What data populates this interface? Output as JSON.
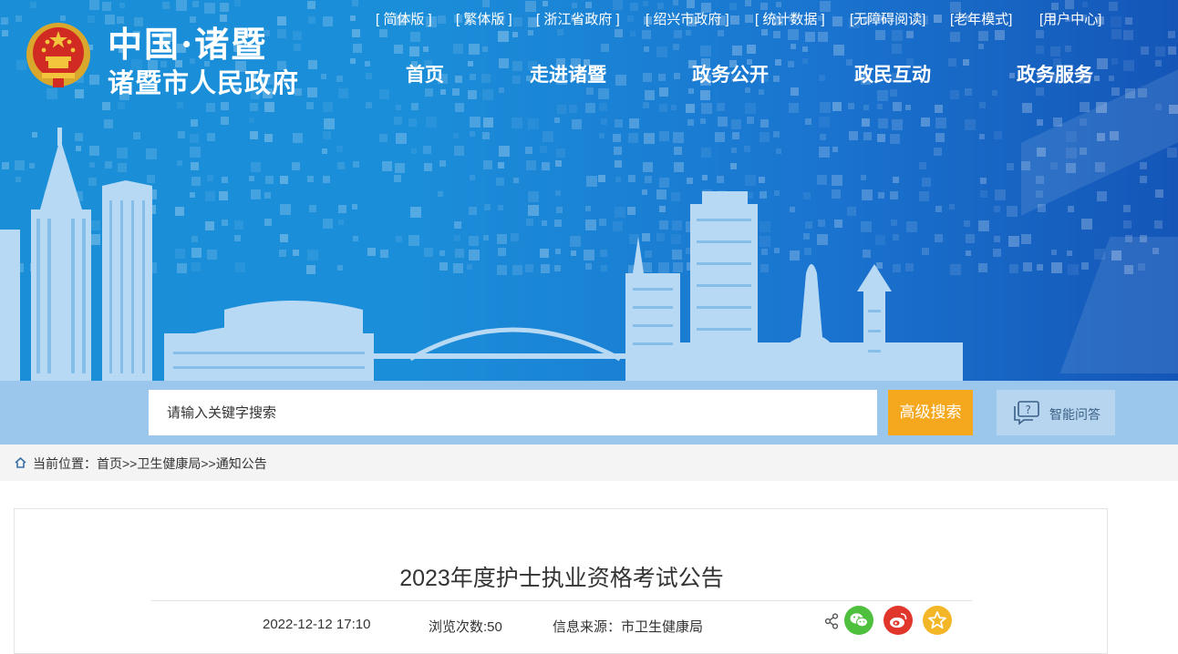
{
  "header": {
    "logo_line1": "中国·诸暨",
    "logo_line2": "诸暨市人民政府",
    "top_links": [
      "[ 简体版 ]",
      "[ 繁体版 ]",
      "[ 浙江省政府 ]",
      "[ 绍兴市政府 ]",
      "[ 统计数据 ]",
      "[无障碍阅读]",
      "[老年模式]",
      "[用户中心]"
    ],
    "nav": [
      "首页",
      "走进诸暨",
      "政务公开",
      "政民互动",
      "政务服务"
    ]
  },
  "search": {
    "placeholder": "请输入关键字搜索",
    "advanced_label": "高级搜索",
    "qa_label": "智能问答"
  },
  "breadcrumb": {
    "prefix": "当前位置：",
    "items": [
      "首页",
      "卫生健康局",
      "通知公告"
    ],
    "separator": ">>"
  },
  "article": {
    "title": "2023年度护士执业资格考试公告",
    "date": "2022-12-12 17:10",
    "views": "浏览次数:50",
    "source": "信息来源：市卫生健康局"
  },
  "colors": {
    "banner_blue": "#1a8fd8",
    "search_band": "#9cc7ec",
    "advanced_button": "#f5a81d",
    "wechat_green": "#4fbf3e",
    "weibo_red": "#e0362b",
    "favorite_yellow": "#f3b627"
  },
  "icons": {
    "emblem": "national-emblem",
    "breadcrumb": "home-icon",
    "qa": "chat-question-icon",
    "share": "share-icon",
    "wechat": "wechat-icon",
    "weibo": "weibo-icon",
    "favorite": "star-icon"
  }
}
